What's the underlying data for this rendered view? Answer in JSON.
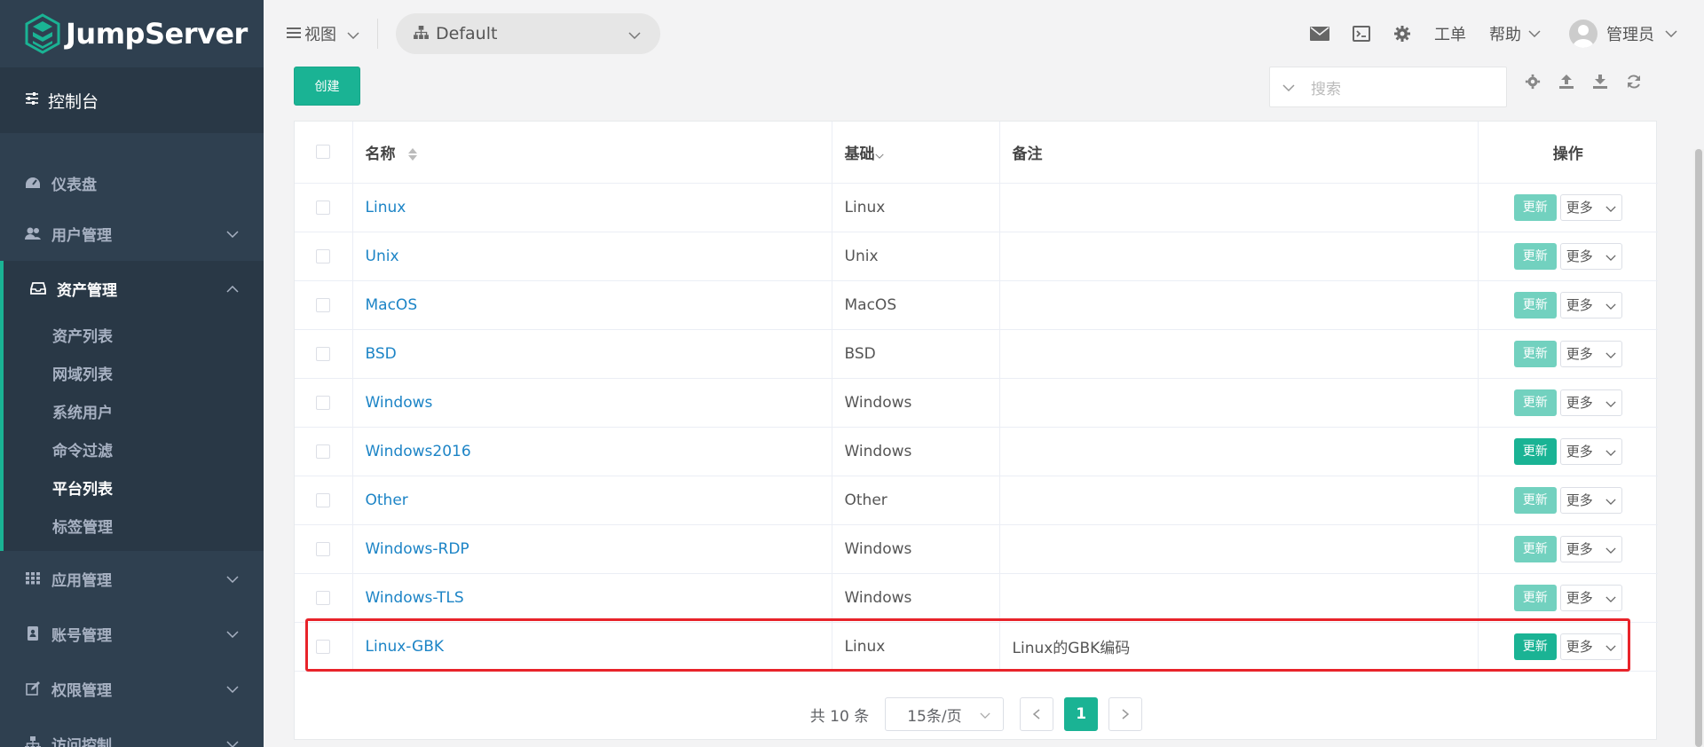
{
  "app": {
    "name": "JumpServer"
  },
  "sidebar": {
    "console": "控制台",
    "items": [
      {
        "label": "仪表盘"
      },
      {
        "label": "用户管理"
      },
      {
        "label": "资产管理"
      },
      {
        "label": "应用管理"
      },
      {
        "label": "账号管理"
      },
      {
        "label": "权限管理"
      },
      {
        "label": "访问控制"
      }
    ],
    "asset_sub": [
      "资产列表",
      "网域列表",
      "系统用户",
      "命令过滤",
      "平台列表",
      "标签管理"
    ],
    "active_sub": "平台列表"
  },
  "topbar": {
    "view": "视图",
    "org": "Default",
    "ticket": "工单",
    "help": "帮助",
    "user": "管理员"
  },
  "toolbar": {
    "create": "创建",
    "search_placeholder": "搜索"
  },
  "table": {
    "headers": {
      "name": "名称",
      "base": "基础",
      "comment": "备注",
      "actions": "操作"
    },
    "update_label": "更新",
    "more_label": "更多",
    "rows": [
      {
        "name": "Linux",
        "base": "Linux",
        "comment": "",
        "update_active": false
      },
      {
        "name": "Unix",
        "base": "Unix",
        "comment": "",
        "update_active": false
      },
      {
        "name": "MacOS",
        "base": "MacOS",
        "comment": "",
        "update_active": false
      },
      {
        "name": "BSD",
        "base": "BSD",
        "comment": "",
        "update_active": false
      },
      {
        "name": "Windows",
        "base": "Windows",
        "comment": "",
        "update_active": false
      },
      {
        "name": "Windows2016",
        "base": "Windows",
        "comment": "",
        "update_active": true
      },
      {
        "name": "Other",
        "base": "Other",
        "comment": "",
        "update_active": false
      },
      {
        "name": "Windows-RDP",
        "base": "Windows",
        "comment": "",
        "update_active": false
      },
      {
        "name": "Windows-TLS",
        "base": "Windows",
        "comment": "",
        "update_active": false
      },
      {
        "name": "Linux-GBK",
        "base": "Linux",
        "comment": "Linux的GBK编码",
        "update_active": true
      }
    ]
  },
  "pagination": {
    "total": "共 10 条",
    "page_size": "15条/页",
    "current_page": "1"
  },
  "colors": {
    "accent": "#1ab394",
    "sidebar": "#2f4050",
    "link": "#1c84c6",
    "highlight": "#e8232a"
  }
}
